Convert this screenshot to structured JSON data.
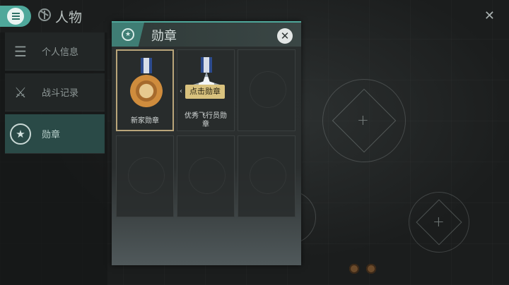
{
  "topbar": {
    "title": "人物",
    "close": "✕"
  },
  "sidebar": {
    "items": [
      {
        "label": "个人信息",
        "icon": "list-icon"
      },
      {
        "label": "战斗记录",
        "icon": "crossed-swords-icon"
      },
      {
        "label": "勋章",
        "icon": "star-badge-icon",
        "active": true
      }
    ]
  },
  "popup": {
    "title": "勋章",
    "close": "✕",
    "tooltip": "点击勋章",
    "medals": [
      {
        "label": "新家勋章",
        "selected": true
      },
      {
        "label": "优秀飞行员勋\n章",
        "selected": false
      }
    ]
  },
  "colors": {
    "accent": "#4fa89b",
    "tooltip": "#d9c27e"
  }
}
